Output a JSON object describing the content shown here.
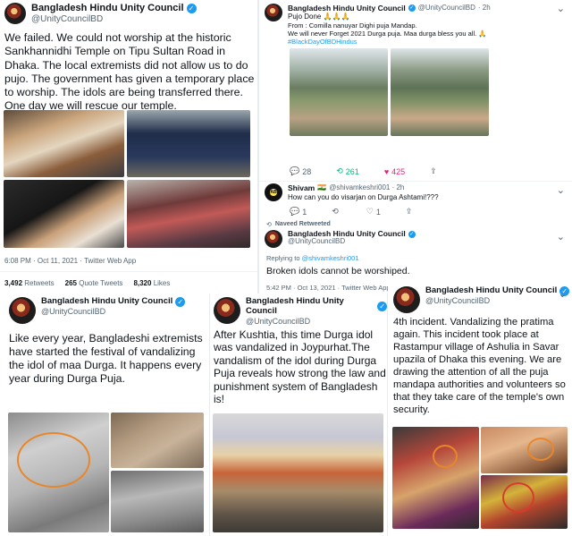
{
  "tweet1": {
    "name": "Bangladesh Hindu Unity Council",
    "handle": "@UnityCouncilBD",
    "text": "We failed. We could not worship at the historic Sankhannidhi Temple on Tipu Sultan Road in Dhaka. The local extremists did not allow us to do pujo. The government has given a temporary place to worship. The idols are being transferred there. One day we will rescue our temple.",
    "time": "6:08 PM · Oct 11, 2021 · Twitter Web App",
    "retweets": "3,492",
    "retweets_label": "Retweets",
    "quotes": "265",
    "quotes_label": "Quote Tweets",
    "likes": "8,320",
    "likes_label": "Likes"
  },
  "tweet2": {
    "time": "· 2h",
    "line1": "Pujo Done",
    "line1_emoji": "🙏🙏🙏",
    "line2": "From : Comilla nanuyar Dighi puja Mandap.",
    "line3": "We will never Forget 2021 Durga puja. Maa durga bless you all.",
    "line3_emoji": "🙏",
    "hashtag": "#BlackDayOfBDHindus",
    "replies": "28",
    "retweets": "261",
    "likes": "425"
  },
  "reply": {
    "name": "Shivam",
    "flag": "🇮🇳",
    "handle": "@shivamkeshri001 · 2h",
    "text": "How can you do visarjan on Durga Ashtami!???",
    "replies": "1",
    "retweets": "",
    "likes": "1",
    "retweeted_label": "Naveed Retweeted",
    "avatar_text": "PABL"
  },
  "tweet3": {
    "replying": "Replying to",
    "replying_to": "@shivamkeshri001",
    "text": "Broken idols cannot be worshiped.",
    "time": "5:42 PM · Oct 13, 2021 · Twitter Web App"
  },
  "tweet4": {
    "text": "Like every year, Bangladeshi extremists have started the festival of vandalizing the idol of maa Durga. It happens every year during Durga Puja."
  },
  "tweet5": {
    "text": "After Kushtia, this time Durga idol was vandalized in Joypurhat.The vandalism of the idol during Durga Puja reveals how strong the law and punishment system of Bangladesh is!"
  },
  "tweet6": {
    "text": "4th incident. Vandalizing the pratima again. This incident took place at Rastampur village of Ashulia in Savar upazila of Dhaka this evening. We are drawing the attention of all the puja mandapa authorities and volunteers so that they take care of the temple's own security."
  },
  "common": {
    "name": "Bangladesh Hindu Unity Council",
    "handle": "@UnityCouncilBD",
    "verified_glyph": "✓",
    "more_glyph": "⌄"
  },
  "colors": {
    "accent": "#1d9bf0",
    "retweet": "#00ba7c",
    "like": "#f91880"
  }
}
